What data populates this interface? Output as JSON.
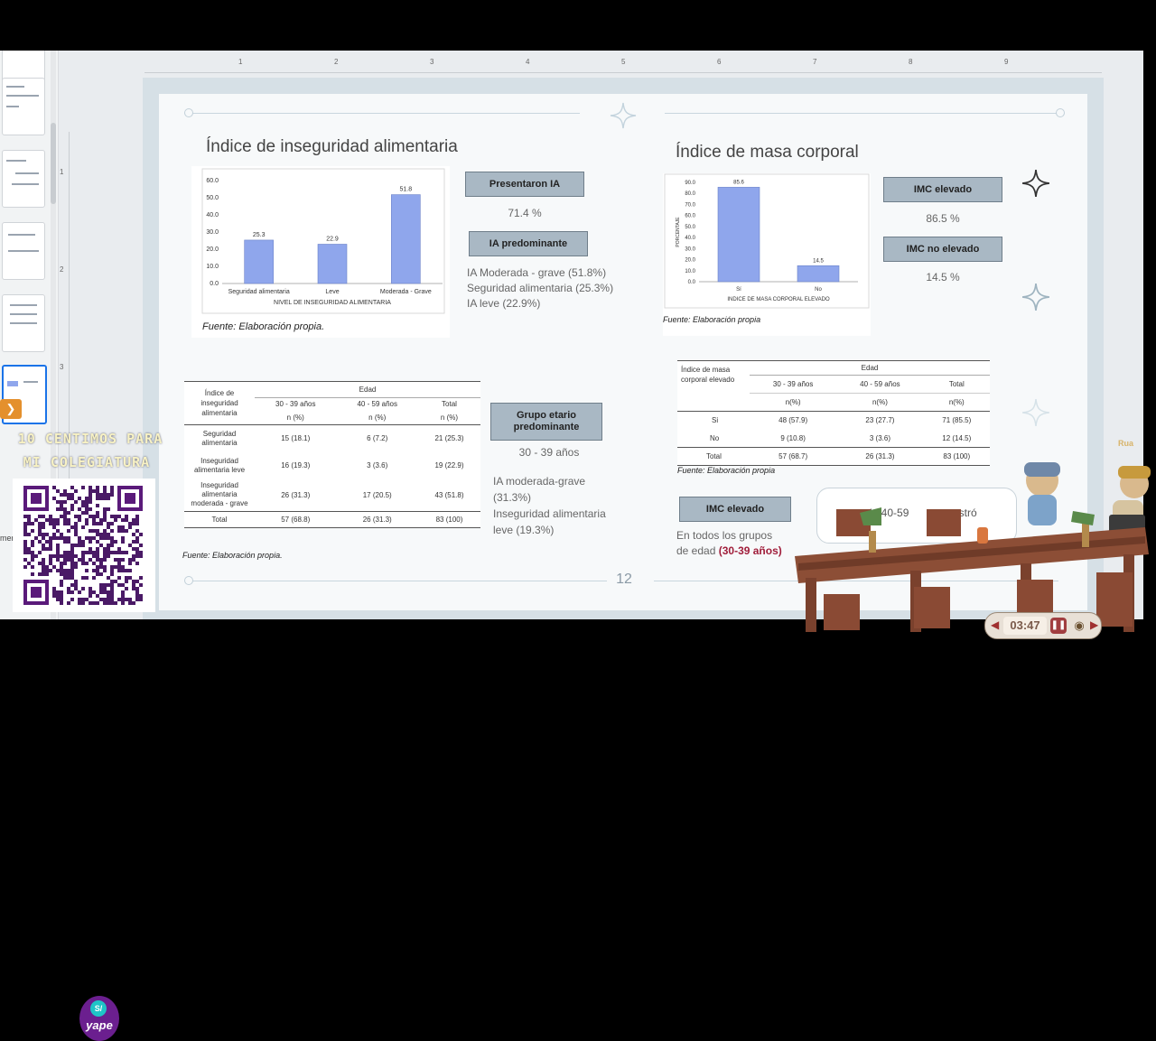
{
  "ruler_top_marks": [
    "1",
    "2",
    "3",
    "4",
    "5",
    "6",
    "7",
    "8",
    "9"
  ],
  "ruler_left_marks": [
    "1",
    "2",
    "3"
  ],
  "slide": {
    "page_number": "12",
    "left": {
      "title": "Índice de inseguridad alimentaria",
      "chart_caption": "Fuente: Elaboración propia.",
      "tag1": "Presentaron IA",
      "tag1_value": "71.4 %",
      "tag2": "IA predominante",
      "tag2_lines": [
        "IA Moderada - grave (51.8%)",
        "Seguridad alimentaria (25.3%)",
        "IA leve (22.9%)"
      ]
    },
    "right": {
      "title": "Índice de masa corporal",
      "chart_caption": "Fuente: Elaboración propia",
      "tag1": "IMC elevado",
      "tag1_value": "86.5 %",
      "tag2": "IMC no elevado",
      "tag2_value": "14.5 %"
    },
    "table1": {
      "header_main": "Edad",
      "row_header": "Índice de inseguridad alimentaria",
      "col_groups": [
        "30 - 39 años",
        "40 - 59 años",
        "Total"
      ],
      "col_units": [
        "n (%)",
        "n (%)",
        "n (%)"
      ],
      "rows": [
        {
          "label": "Seguridad alimentaria",
          "cells": [
            "15 (18.1)",
            "6 (7.2)",
            "21 (25.3)"
          ]
        },
        {
          "label": "Inseguridad alimentaria leve",
          "cells": [
            "16 (19.3)",
            "3 (3.6)",
            "19 (22.9)"
          ]
        },
        {
          "label": "Inseguridad alimentaria moderada - grave",
          "cells": [
            "26 (31.3)",
            "17 (20.5)",
            "43 (51.8)"
          ]
        },
        {
          "label": "Total",
          "cells": [
            "57 (68.8)",
            "26 (31.3)",
            "83 (100)"
          ]
        }
      ],
      "caption": "Fuente: Elaboración propia."
    },
    "group_tag": "Grupo etario predominante",
    "group_value": "30 - 39 años",
    "group_note": [
      "IA moderada-grave",
      "(31.3%)",
      "Inseguridad alimentaria",
      "leve (19.3%)"
    ],
    "table2": {
      "header_main": "Edad",
      "row_header": "Índice de masa corporal elevado",
      "col_groups": [
        "30 - 39 años",
        "40 - 59 años",
        "Total"
      ],
      "col_units": [
        "n(%)",
        "n(%)",
        "n(%)"
      ],
      "rows": [
        {
          "label": "Si",
          "cells": [
            "48 (57.9)",
            "23 (27.7)",
            "71 (85.5)"
          ]
        },
        {
          "label": "No",
          "cells": [
            "9 (10.8)",
            "3 (3.6)",
            "12 (14.5)"
          ]
        },
        {
          "label": "Total",
          "cells": [
            "57 (68.7)",
            "26 (31.3)",
            "83 (100)"
          ]
        }
      ],
      "caption": "Fuente: Elaboración propia"
    },
    "imc_tag": "IMC elevado",
    "imc_note_line1": "En todos los grupos",
    "imc_note_line2": "de edad",
    "imc_note_emph": "(30-39 años)",
    "box_text_a": "de 40-59",
    "box_text_b": "mostró"
  },
  "overlay": {
    "promo_line1": "10 CENTIMOS PARA",
    "promo_line2": "MI COLEGIATURA",
    "yape_label": "yape",
    "yape_badge": "S/",
    "sidebar_tab": "mer",
    "timer": "03:47",
    "sticker_text": "Rua"
  },
  "chart_data": [
    {
      "type": "bar",
      "title": "",
      "xlabel": "NIVEL DE INSEGURIDAD ALIMENTARIA",
      "ylabel": "",
      "categories": [
        "Seguridad alimentaria",
        "Leve",
        "Moderada - Grave"
      ],
      "values": [
        25.3,
        22.9,
        51.8
      ],
      "ylim": [
        0,
        60
      ],
      "yticks": [
        "0.0",
        "10.0",
        "20.0",
        "30.0",
        "40.0",
        "50.0",
        "60.0"
      ],
      "grid": false,
      "bar_color": "#8fa6ec"
    },
    {
      "type": "bar",
      "title": "",
      "xlabel": "INDICE DE MASA CORPORAL ELEVADO",
      "ylabel": "PORCENTAJE",
      "categories": [
        "Sí",
        "No"
      ],
      "values": [
        85.6,
        14.5
      ],
      "ylim": [
        0,
        90
      ],
      "yticks": [
        "0.0",
        "10.0",
        "20.0",
        "30.0",
        "40.0",
        "50.0",
        "60.0",
        "70.0",
        "80.0",
        "90.0"
      ],
      "grid": false,
      "bar_color": "#8fa6ec"
    }
  ]
}
